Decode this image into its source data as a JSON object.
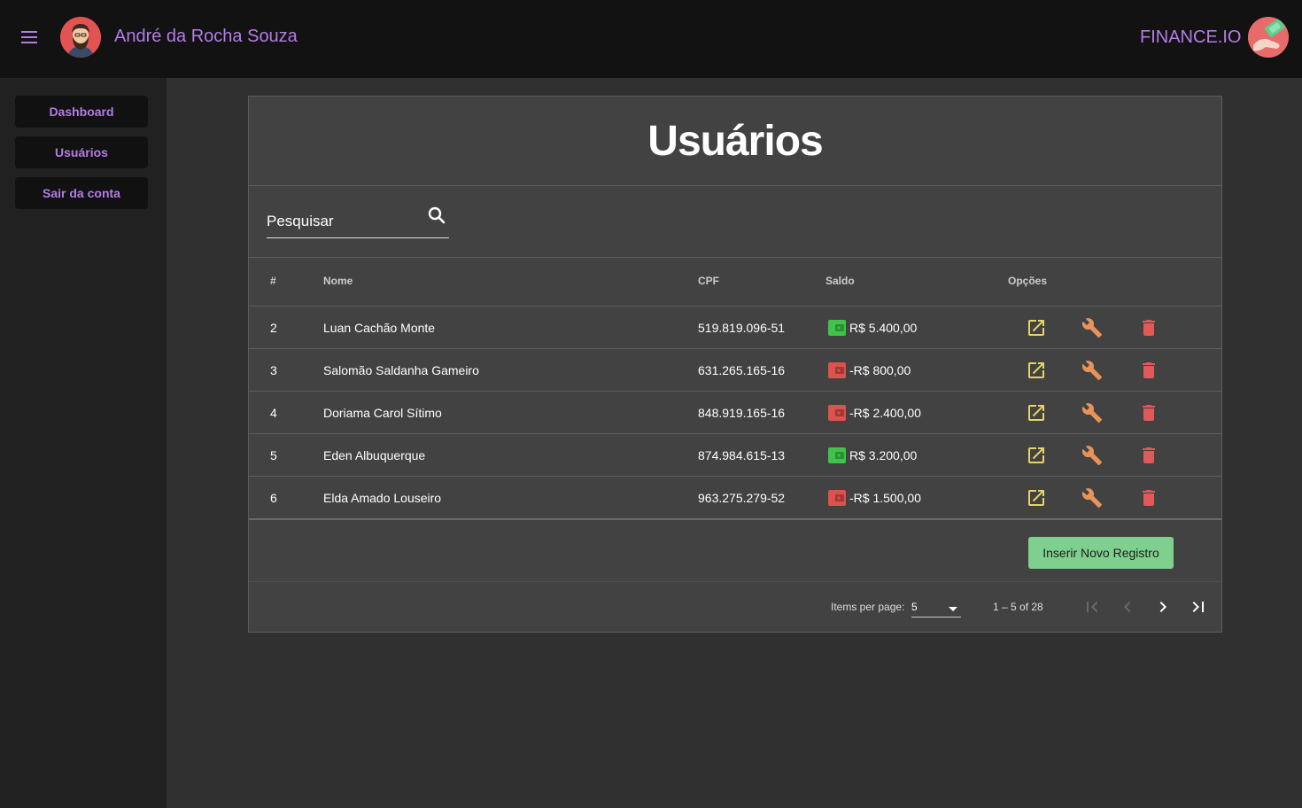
{
  "header": {
    "user_name": "André da Rocha Souza",
    "brand": "FINANCE.IO"
  },
  "sidebar": {
    "items": [
      {
        "label": "Dashboard"
      },
      {
        "label": "Usuários"
      },
      {
        "label": "Sair da conta"
      }
    ]
  },
  "card": {
    "title": "Usuários",
    "search_placeholder": "Pesquisar"
  },
  "table": {
    "columns": [
      "#",
      "Nome",
      "CPF",
      "Saldo",
      "Opções"
    ],
    "rows": [
      {
        "id": "2",
        "nome": "Luan Cachão Monte",
        "cpf": "519.819.096-51",
        "saldo": "R$ 5.400,00",
        "status": "positive"
      },
      {
        "id": "3",
        "nome": "Salomão Saldanha Gameiro",
        "cpf": "631.265.165-16",
        "saldo": "-R$ 800,00",
        "status": "negative"
      },
      {
        "id": "4",
        "nome": "Doriama Carol Sítimo",
        "cpf": "848.919.165-16",
        "saldo": "-R$ 2.400,00",
        "status": "negative"
      },
      {
        "id": "5",
        "nome": "Eden Albuquerque",
        "cpf": "874.984.615-13",
        "saldo": "R$ 3.200,00",
        "status": "positive"
      },
      {
        "id": "6",
        "nome": "Elda Amado Louseiro",
        "cpf": "963.275.279-52",
        "saldo": "-R$ 1.500,00",
        "status": "negative"
      }
    ]
  },
  "actions": {
    "insert_label": "Inserir Novo Registro"
  },
  "pagination": {
    "items_per_page_label": "Items per page:",
    "items_per_page_value": "5",
    "range": "1 – 5 of 28"
  },
  "colors": {
    "accent": "#b47ce6",
    "positive_wallet": "#3fc34a",
    "negative_wallet": "#d9534f",
    "edit_icon": "#e6d36a",
    "wrench_icon": "#e8935a",
    "delete_icon": "#e05a5a",
    "insert_button": "#7fd08e"
  },
  "icons": {
    "row_actions": [
      "open-in-new-icon",
      "wrench-icon",
      "trash-icon"
    ],
    "pagination": [
      "first-page-icon",
      "previous-page-icon",
      "next-page-icon",
      "last-page-icon"
    ]
  }
}
